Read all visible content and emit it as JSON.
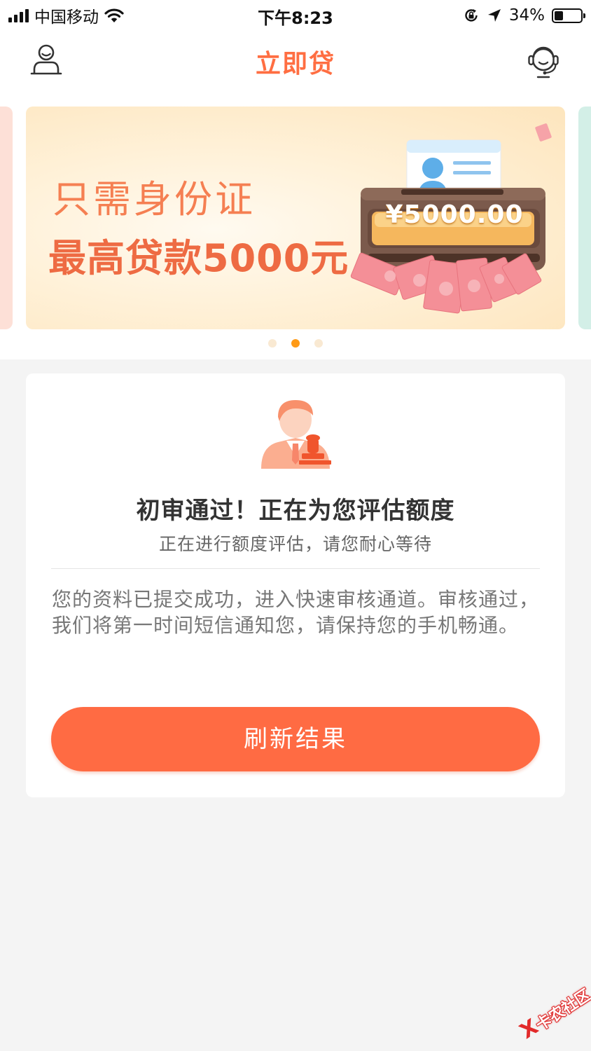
{
  "status_bar": {
    "carrier": "中国移动",
    "time": "下午8:23",
    "battery": "34%",
    "battery_level": 0.34,
    "icons": [
      "signal-icon",
      "wifi-icon",
      "orientation-lock-icon",
      "location-arrow-icon",
      "battery-icon"
    ]
  },
  "nav": {
    "title": "立即贷",
    "left_icon": "user-profile-icon",
    "right_icon": "customer-service-icon"
  },
  "banner": {
    "line1": "只需身份证",
    "line2": "最高贷款5000元",
    "amount": "¥5000.00",
    "page_count": 3,
    "active_page": 2
  },
  "card": {
    "icon": "reviewer-stamp-icon",
    "title": "初审通过！正在为您评估额度",
    "subtitle": "正在进行额度评估，请您耐心等待",
    "body": "您的资料已提交成功，进入快速审核通道。审核通过，我们将第一时间短信通知您，请保持您的手机畅通。",
    "button": "刷新结果"
  },
  "watermark": {
    "text": "卡农社区"
  },
  "colors": {
    "accent": "#ff6b43",
    "title": "#ff6e42",
    "page_bg": "#f4f4f4",
    "dot_active": "#ff9a16"
  }
}
